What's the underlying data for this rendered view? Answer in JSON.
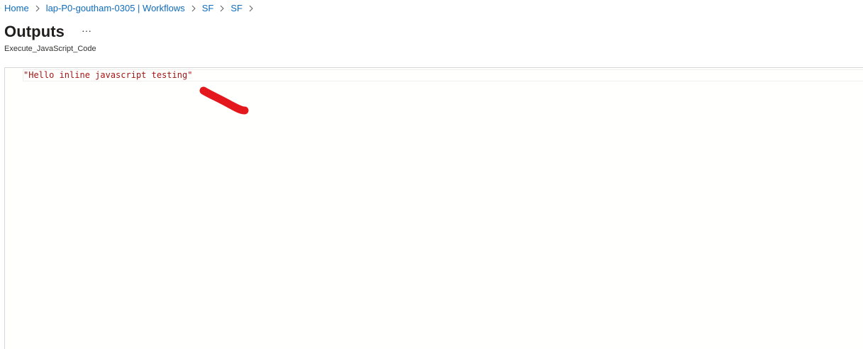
{
  "breadcrumb": {
    "items": [
      "Home",
      "lap-P0-goutham-0305 | Workflows",
      "SF",
      "SF"
    ]
  },
  "header": {
    "title": "Outputs",
    "more_label": "···",
    "subtitle": "Execute_JavaScript_Code"
  },
  "editor": {
    "content": "\"Hello inline javascript testing\""
  },
  "colors": {
    "link": "#0f6cbd",
    "string": "#a31515",
    "annotation": "#e3171c"
  },
  "icons": {
    "separator": "chevron-right-icon",
    "more": "more-icon"
  }
}
